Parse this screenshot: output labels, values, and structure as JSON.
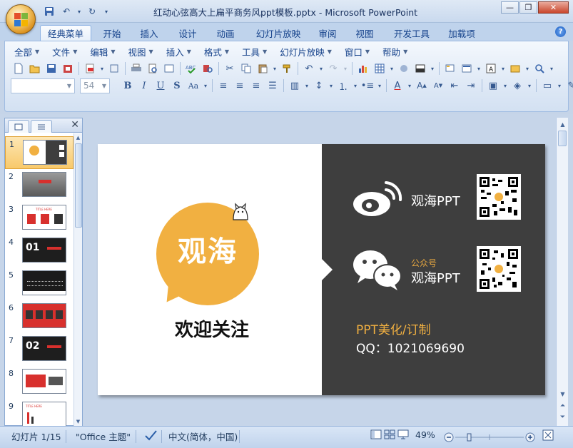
{
  "window": {
    "title": "红动心弦高大上扁平商务风ppt模板.pptx - Microsoft PowerPoint",
    "controls": {
      "minimize": "—",
      "restore": "❐",
      "close": "✕"
    }
  },
  "quick_access": [
    "save-icon",
    "undo-icon",
    "redo-icon",
    "customize-icon"
  ],
  "tabs": [
    {
      "label": "经典菜单",
      "active": true
    },
    {
      "label": "开始"
    },
    {
      "label": "插入"
    },
    {
      "label": "设计"
    },
    {
      "label": "动画"
    },
    {
      "label": "幻灯片放映"
    },
    {
      "label": "审阅"
    },
    {
      "label": "视图"
    },
    {
      "label": "开发工具"
    },
    {
      "label": "加载项"
    }
  ],
  "menu": [
    "全部",
    "文件",
    "编辑",
    "视图",
    "插入",
    "格式",
    "工具",
    "幻灯片放映",
    "窗口",
    "帮助"
  ],
  "font_size": "54",
  "font_name": "",
  "panel": {
    "tab_slides": "slides",
    "tab_outline": "outline",
    "slides": [
      "1",
      "2",
      "3",
      "4",
      "5",
      "6",
      "7",
      "8",
      "9"
    ],
    "thumb_texts": {
      "s4": "01",
      "s7": "02",
      "s3": "TITLE HERE",
      "s9": "TITLE HERE"
    }
  },
  "slide": {
    "bubble_text": "观海",
    "welcome": "欢迎关注",
    "weibo_name": "观海PPT",
    "wechat_label": "公众号",
    "wechat_name": "观海PPT",
    "contact_line1": "PPT美化/订制",
    "contact_line2": "QQ：1021069690",
    "colors": {
      "accent": "#f1b041",
      "dark_panel": "#3e3e3e"
    }
  },
  "status": {
    "slide_info": "幻灯片 1/15",
    "theme": "\"Office 主题\"",
    "language": "中文(简体，中国)",
    "zoom": "49%"
  }
}
